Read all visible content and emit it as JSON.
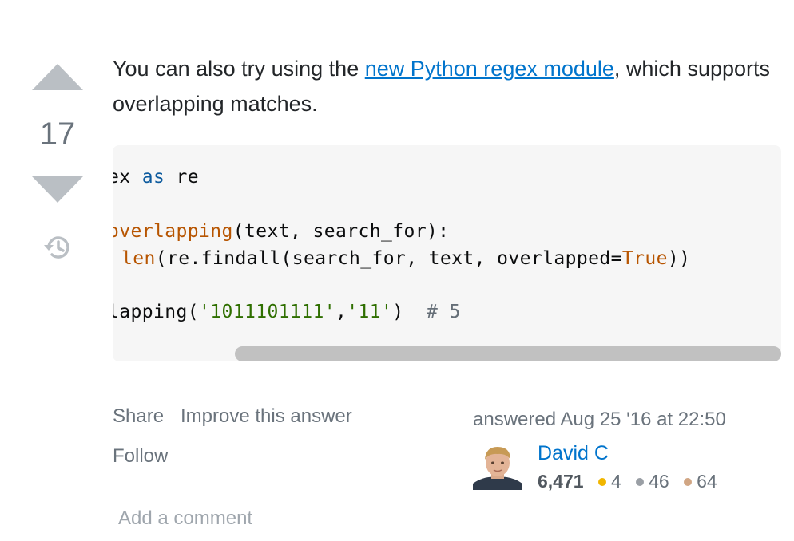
{
  "vote": {
    "count": "17"
  },
  "post": {
    "text_before": "You can also try using the ",
    "link_text": "new Python regex module",
    "text_after": ", which supports overlapping matches."
  },
  "code": {
    "line1": {
      "a": "ex ",
      "b": "as",
      "c": " re"
    },
    "line2": {
      "a": "overlapping",
      "b": "(text, search_for):"
    },
    "line3": {
      "a": "len",
      "b": "(re.findall(search_for, text, overlapped=",
      "c": "True",
      "d": "))"
    },
    "line4": {
      "a": "lapping(",
      "b": "'1011101111'",
      "c": ",",
      "d": "'11'",
      "e": ")  ",
      "f": "# 5"
    }
  },
  "menu": {
    "share": "Share",
    "improve": "Improve this answer",
    "follow": "Follow"
  },
  "user": {
    "answered": "answered Aug 25 '16 at 22:50",
    "name": "David C",
    "reputation": "6,471",
    "gold": "4",
    "silver": "46",
    "bronze": "64"
  },
  "colors": {
    "gold": "#f1b600",
    "silver": "#9a9fa5",
    "bronze": "#d1a684",
    "link": "#0074cc"
  },
  "comment": {
    "add": "Add a comment"
  }
}
